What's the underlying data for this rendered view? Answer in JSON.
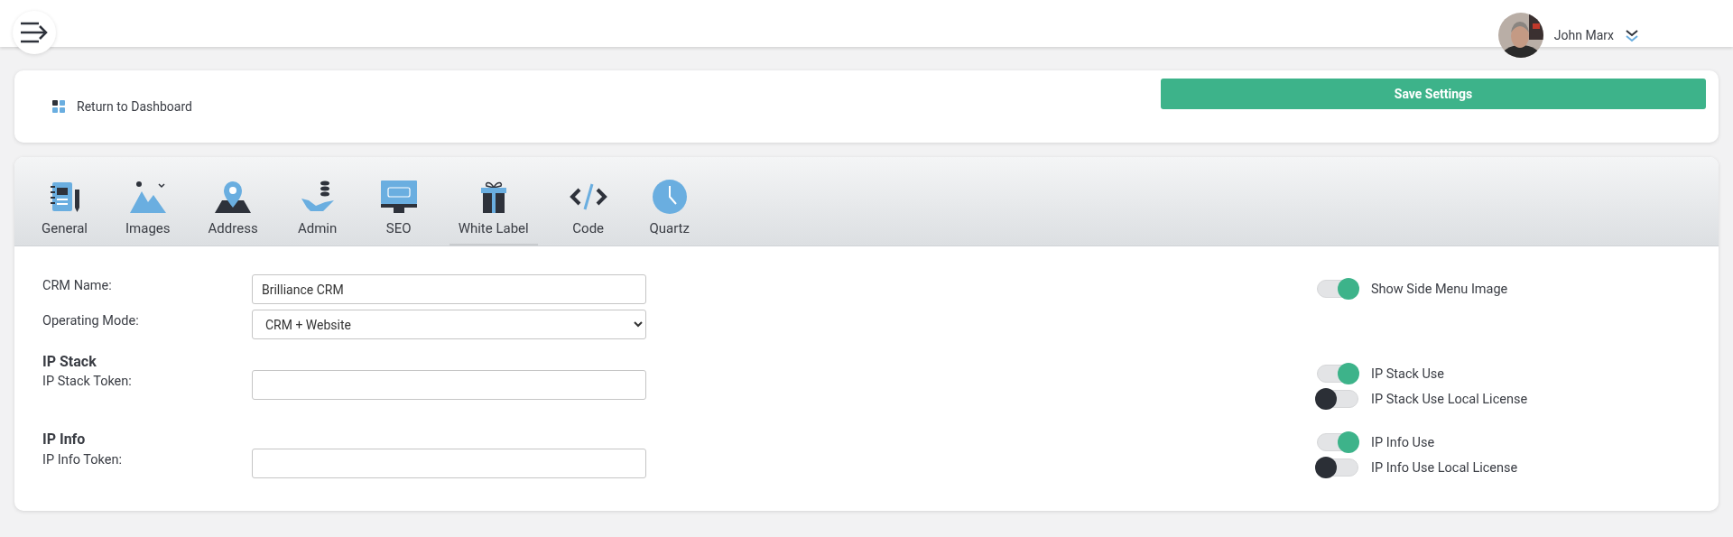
{
  "header": {
    "user_name": "John Marx"
  },
  "actions": {
    "return_link": "Return to Dashboard",
    "save_button": "Save Settings"
  },
  "tabs": [
    {
      "label": "General",
      "selected": false
    },
    {
      "label": "Images",
      "selected": false
    },
    {
      "label": "Address",
      "selected": false
    },
    {
      "label": "Admin",
      "selected": false
    },
    {
      "label": "SEO",
      "selected": false
    },
    {
      "label": "White Label",
      "selected": true
    },
    {
      "label": "Code",
      "selected": false
    },
    {
      "label": "Quartz",
      "selected": false
    }
  ],
  "form": [
    {
      "kind": "text",
      "label": "CRM Name:",
      "value": "Brilliance CRM"
    },
    {
      "kind": "select",
      "label": "Operating Mode:",
      "value": "CRM + Website"
    },
    {
      "kind": "heading",
      "label": "IP Stack"
    },
    {
      "kind": "text",
      "label": "IP Stack Token:"
    },
    {
      "kind": "heading",
      "label": "IP Info"
    },
    {
      "kind": "text",
      "label": "IP Info Token:"
    }
  ],
  "toggles": [
    {
      "label": "Show Side Menu Image",
      "on": true
    },
    {
      "label": "IP Stack Use",
      "on": true
    },
    {
      "label": "IP Stack Use Local License",
      "on": false
    },
    {
      "label": "IP Info Use",
      "on": true
    },
    {
      "label": "IP Info Use Local License",
      "on": false
    }
  ]
}
